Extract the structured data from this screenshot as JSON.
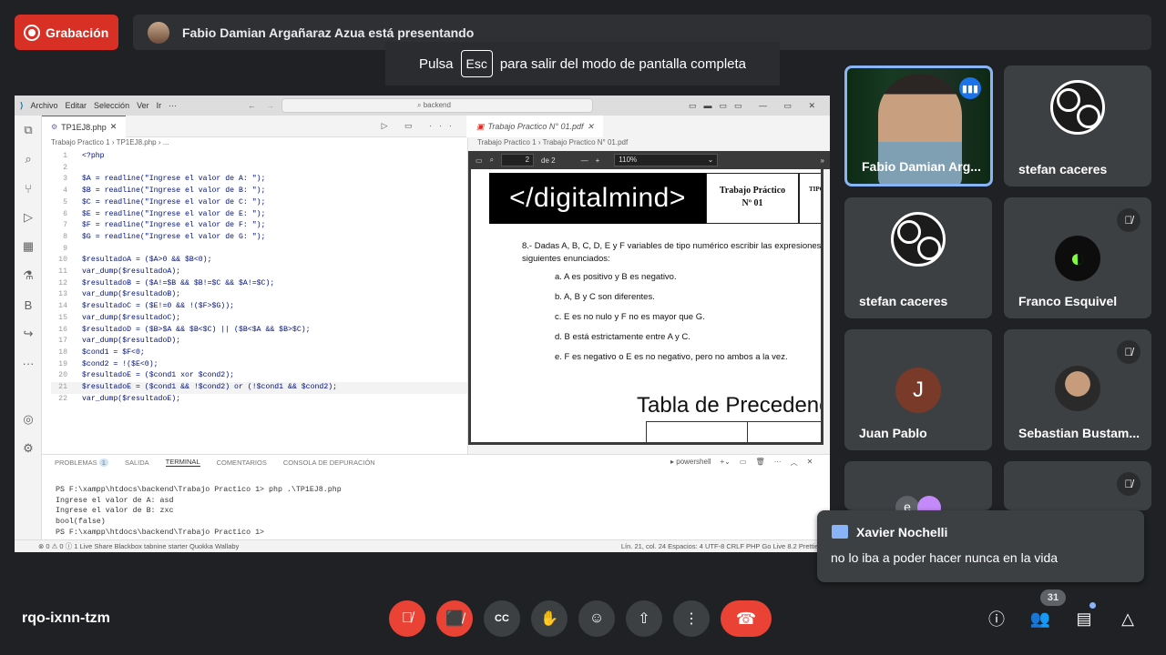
{
  "meet": {
    "recording_label": "Grabación",
    "presenter_banner": "Fabio Damian Argañaraz Azua está presentando",
    "esc_prefix": "Pulsa",
    "esc_key": "Esc",
    "esc_suffix": "para salir del modo de pantalla completa",
    "meeting_code": "rqo-ixnn-tzm",
    "participant_count": "31"
  },
  "participants": [
    {
      "name": "Fabio Damian Arg...",
      "speaking": true
    },
    {
      "name": "stefan caceres"
    },
    {
      "name": "stefan caceres"
    },
    {
      "name": "Franco Esquivel",
      "muted": true
    },
    {
      "name": "Juan Pablo",
      "initial": "J",
      "muted": true
    },
    {
      "name": "Sebastian Bustam...",
      "muted": true
    },
    {
      "name": "e",
      "muted": false
    },
    {
      "name": "",
      "muted": true
    }
  ],
  "chat": {
    "author": "Xavier Nochelli",
    "message": "no lo iba  a poder hacer nunca en la vida"
  },
  "vscode": {
    "menu": [
      "Archivo",
      "Editar",
      "Selección",
      "Ver",
      "Ir",
      "···"
    ],
    "search": "backend",
    "tab": "TP1EJ8.php",
    "breadcrumb": "Trabajo Practico 1 › TP1EJ8.php › ...",
    "code_lines": [
      {
        "n": "1",
        "t": "<?php"
      },
      {
        "n": "2",
        "t": ""
      },
      {
        "n": "3",
        "t": "$A = readline(\"Ingrese el valor de A: \");"
      },
      {
        "n": "4",
        "t": "$B = readline(\"Ingrese el valor de B: \");"
      },
      {
        "n": "5",
        "t": "$C = readline(\"Ingrese el valor de C: \");"
      },
      {
        "n": "6",
        "t": "$E = readline(\"Ingrese el valor de E: \");"
      },
      {
        "n": "7",
        "t": "$F = readline(\"Ingrese el valor de F: \");"
      },
      {
        "n": "8",
        "t": "$G = readline(\"Ingrese el valor de G: \");"
      },
      {
        "n": "9",
        "t": ""
      },
      {
        "n": "10",
        "t": "$resultadoA = ($A>0 && $B<0);"
      },
      {
        "n": "11",
        "t": "var_dump($resultadoA);"
      },
      {
        "n": "12",
        "t": "$resultadoB = ($A!=$B && $B!=$C && $A!=$C);"
      },
      {
        "n": "13",
        "t": "var_dump($resultadoB);"
      },
      {
        "n": "14",
        "t": "$resultadoC = ($E!=0 && !($F>$G));"
      },
      {
        "n": "15",
        "t": "var_dump($resultadoC);"
      },
      {
        "n": "16",
        "t": "$resultadoD = ($B>$A && $B<$C) || ($B<$A && $B>$C);"
      },
      {
        "n": "17",
        "t": "var_dump($resultadoD);"
      },
      {
        "n": "18",
        "t": "$cond1 = $F<0;"
      },
      {
        "n": "19",
        "t": "$cond2 = !($E<0);"
      },
      {
        "n": "20",
        "t": "$resultadoE = ($cond1 xor $cond2);"
      },
      {
        "n": "21",
        "t": "$resultadoE = ($cond1 && !$cond2) or (!$cond1 && $cond2);"
      },
      {
        "n": "22",
        "t": "var_dump($resultadoE);"
      }
    ],
    "panel_tabs": [
      "PROBLEMAS",
      "SALIDA",
      "TERMINAL",
      "COMENTARIOS",
      "CONSOLA DE DEPURACIÓN"
    ],
    "problems_count": "1",
    "terminal_shell": "powershell",
    "terminal_lines": [
      "PS F:\\xampp\\htdocs\\backend\\Trabajo Practico 1> php .\\TP1EJ8.php",
      "Ingrese el valor de A: asd",
      "Ingrese el valor de B: zxc",
      "bool(false)",
      "PS F:\\xampp\\htdocs\\backend\\Trabajo Practico 1> "
    ],
    "status_left": "⊗ 0 ⚠ 0  ⓘ 1    Live Share    Blackbox    tabnine starter    Quokka    Wallaby",
    "status_right": "Lín. 21, col. 24   Espacios: 4   UTF-8   CRLF   PHP   Go Live   8.2   Prettier"
  },
  "pdf": {
    "tab": "Trabajo Practico N° 01.pdf",
    "breadcrumb": "Trabajo Practico 1 › Trabajo Practico N° 01.pdf",
    "page": "2",
    "of_pages": "de 2",
    "zoom": "110%",
    "logo": "</digitalmind>",
    "tp_title": "Trabajo Práctico",
    "tp_num": "Nº 01",
    "tipo": "TIPO",
    "question": "8.- Dadas A, B, C, D, E y F variables de tipo numérico escribir las expresiones siguientes enunciados:",
    "options": [
      "a. A es positivo y B es negativo.",
      "b. A, B y C son diferentes.",
      "c. E es no nulo y F no es mayor que G.",
      "d. B está estrictamente entre A y C.",
      "e. F es negativo o E es no negativo, pero no ambos a la vez."
    ],
    "table_title": "Tabla de Precedenc"
  }
}
